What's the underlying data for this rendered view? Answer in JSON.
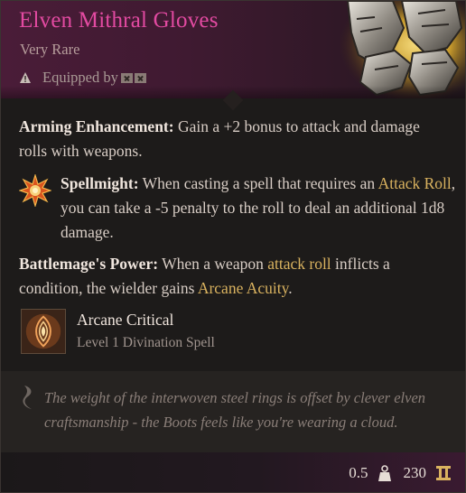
{
  "item": {
    "name": "Elven Mithral Gloves",
    "rarity": "Very Rare",
    "equipped_label": "Equipped by"
  },
  "properties": {
    "arming": {
      "name": "Arming Enhancement:",
      "text": "Gain a +2 bonus to attack and damage rolls with weapons."
    },
    "spellmight": {
      "name": "Spellmight:",
      "text_1": "When casting a spell that requires an",
      "link_1": "Attack Roll",
      "text_2": ", you can take a -5 penalty to the roll to deal an additional 1d8 damage."
    },
    "battlemage": {
      "name": "Battlemage's Power:",
      "text_1": "When a weapon",
      "link_1": "attack roll",
      "text_2": "inflicts a condition, the wielder gains",
      "link_2": "Arcane Acuity",
      "text_3": "."
    }
  },
  "spell": {
    "name": "Arcane Critical",
    "level": "Level 1 Divination Spell",
    "icon": "arcane-critical-icon"
  },
  "flavor": {
    "text": "The weight of the interwoven steel rings is offset by clever elven craftsmanship - the Boots feels like you're wearing a cloud."
  },
  "footer": {
    "weight": "0.5",
    "value": "230"
  },
  "colors": {
    "title": "#e24aa1",
    "highlight": "#d9b25f",
    "header_bg": "#4a1c38"
  }
}
